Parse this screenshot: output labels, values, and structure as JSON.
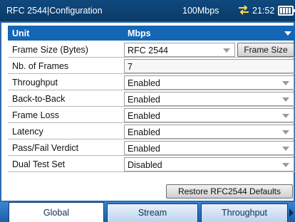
{
  "header": {
    "title": "RFC 2544|Configuration",
    "speed": "100Mbps",
    "link_icon": "link-arrows-icon",
    "time": "21:52",
    "battery_icon": "battery-icon"
  },
  "unit": {
    "label": "Unit",
    "value": "Mbps"
  },
  "settings": [
    {
      "label": "Frame Size (Bytes)",
      "value": "RFC 2544",
      "button": "Frame Size"
    },
    {
      "label": "Nb. of Frames",
      "value": "7"
    },
    {
      "label": "Throughput",
      "value": "Enabled"
    },
    {
      "label": "Back-to-Back",
      "value": "Enabled"
    },
    {
      "label": "Frame Loss",
      "value": "Enabled"
    },
    {
      "label": "Latency",
      "value": "Enabled"
    },
    {
      "label": "Pass/Fail Verdict",
      "value": "Enabled"
    },
    {
      "label": "Dual Test Set",
      "value": "Disabled"
    }
  ],
  "restore_button": "Restore RFC2544 Defaults",
  "tabs": [
    {
      "label": "Global",
      "active": true
    },
    {
      "label": "Stream",
      "active": false
    },
    {
      "label": "Throughput",
      "active": false
    }
  ],
  "colors": {
    "title_bar": "#0a3a67",
    "unit_row": "#1566b5",
    "tab_bar": "#1d5fa8"
  }
}
